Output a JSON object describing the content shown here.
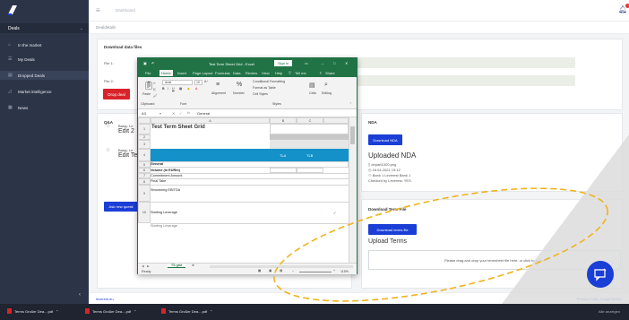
{
  "topbar": {
    "title": "Dashboard"
  },
  "breadcrumb": "Dealdetails",
  "sidebar": {
    "group_label": "Deals",
    "items": [
      {
        "label": "In the market",
        "icon": "storefront-icon"
      },
      {
        "label": "My Deals",
        "icon": "list-icon"
      },
      {
        "label": "Dropped Deals",
        "icon": "trash-icon"
      },
      {
        "label": "Market intelligence",
        "icon": "chart-icon"
      },
      {
        "label": "News",
        "icon": "newspaper-icon"
      }
    ]
  },
  "download_card": {
    "title": "Download data files",
    "file1_label": "File 1:",
    "file2_label": "File 2:",
    "drop_deal_button": "Drop deal"
  },
  "qa": {
    "title": "Q&A",
    "items": [
      {
        "small": "Basic: Le",
        "big": "Edit 2"
      },
      {
        "small": "Basic: Le",
        "big": "Edit Te"
      }
    ],
    "ask_button": "Ask new questi"
  },
  "nda": {
    "title": "NDA",
    "download_button": "Download NDA",
    "uploaded_heading": "Uploaded NDA",
    "file_name": "ctrpart1000.png",
    "date": "18.04.2021 19:12",
    "bank": "Bank 1 Leverest Bank 1",
    "checked_by": "Checked by Leverest: YES"
  },
  "terms": {
    "title": "Download Term File",
    "download_button": "Download terms file",
    "upload_heading": "Upload Terms",
    "dropzone_text": "Please drag and drop your termsheet file here, or click to select"
  },
  "footer": {
    "left": "leverest.eu",
    "right": "Privacy Policy | Legal Notice"
  },
  "taskbar": {
    "items": [
      "Terms Großer Dea....pdf",
      "Terms Großer Dea....pdf",
      "Terms Großer Dea....pdf"
    ],
    "show_all": "Alle anzeigen"
  },
  "excel": {
    "title": "Test Term Sheet Grid - Excel",
    "signin": "Sign in",
    "menu": [
      "File",
      "Home",
      "Insert",
      "Page Layout",
      "Formulas",
      "Data",
      "Review",
      "View",
      "Help",
      "Tell me",
      "Share"
    ],
    "font_name": "Arial",
    "font_size": "10",
    "ribbon_groups": [
      "Clipboard",
      "Font",
      "Alignment",
      "Number",
      "Styles",
      "Cells",
      "Editing"
    ],
    "styles_items": [
      "Conditional Formatting",
      "Format as Table",
      "Cell Styles"
    ],
    "cell_ref": "A3",
    "formula_value": "General",
    "col_headers": [
      "A",
      "B",
      "C"
    ],
    "row_numbers": [
      "1",
      "2",
      "3",
      "4",
      "5",
      "6",
      "7",
      "8",
      "9",
      "10"
    ],
    "heading": "Test Term Sheet Grid",
    "tla": "TLA",
    "tlb": "TLB",
    "rows": [
      "General",
      "Volume (in EURm)",
      "Commitment Amount",
      "Final Take",
      "Structuring EBITDA",
      "Starting Leverage",
      "Starting Leverage"
    ],
    "sheet_tab": "TS grid",
    "status_ready": "Ready",
    "zoom": "115%"
  }
}
